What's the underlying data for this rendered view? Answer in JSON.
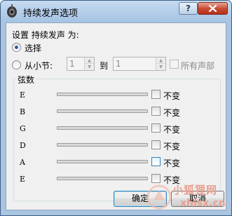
{
  "window": {
    "title": "持续发声选项"
  },
  "section_label": "设置 持续发声 为:",
  "option_select": {
    "label": "选择",
    "selected": true
  },
  "option_measure": {
    "label": "从小节:",
    "selected": false,
    "from_value": "1",
    "to_label": "到",
    "to_value": "1",
    "all_voices_label": "所有声部"
  },
  "strings_group": {
    "title": "弦数",
    "rows": [
      {
        "name": "E",
        "unchanged_label": "不变"
      },
      {
        "name": "B",
        "unchanged_label": "不变"
      },
      {
        "name": "G",
        "unchanged_label": "不变"
      },
      {
        "name": "D",
        "unchanged_label": "不变"
      },
      {
        "name": "A",
        "unchanged_label": "不变"
      },
      {
        "name": "E",
        "unchanged_label": "不变"
      }
    ]
  },
  "buttons": {
    "ok": "确定",
    "cancel": "取消"
  },
  "watermark": {
    "line1": "小狐狸网",
    "line2": "xhlsx.cn"
  },
  "icons": {
    "app": "guitar-app-icon",
    "help": "help-icon",
    "close": "close-icon",
    "spin_up": "arrow-up-icon",
    "spin_down": "arrow-down-icon"
  },
  "colors": {
    "titlebar": "#a9c5e2",
    "close_button": "#c7462f",
    "dialog_bg": "#f0f0f0",
    "default_button_border": "#3c7fb1",
    "radio_dot": "#2c5b9a"
  }
}
